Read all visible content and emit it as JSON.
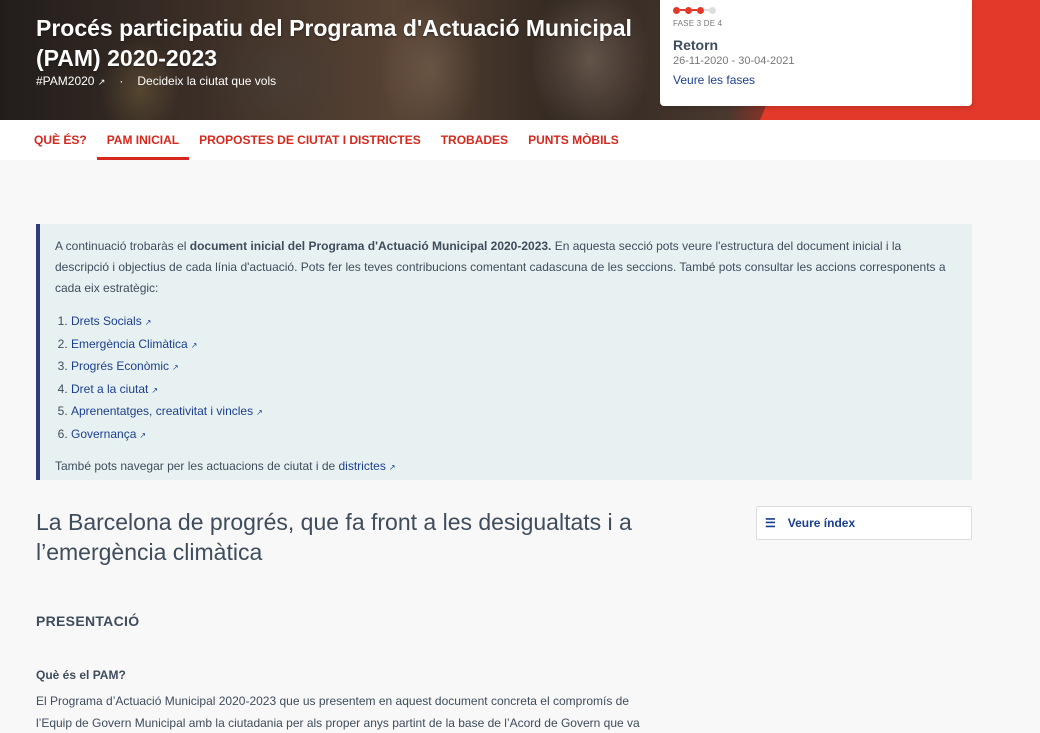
{
  "hero": {
    "title": "Procés participatiu del Programa d'Actuació Municipal (PAM) 2020-2023",
    "hashtag": "#PAM2020",
    "slogan": "Decideix la ciutat que vols"
  },
  "phase": {
    "step_label": "FASE 3 DE 4",
    "current": 3,
    "total": 4,
    "name": "Retorn",
    "dates": "26-11-2020 - 30-04-2021",
    "link": "Veure les fases"
  },
  "nav": {
    "items": [
      {
        "label": "QUÈ ÉS?"
      },
      {
        "label": "PAM INICIAL"
      },
      {
        "label": "PROPOSTES DE CIUTAT I DISTRICTES"
      },
      {
        "label": "TROBADES"
      },
      {
        "label": "PUNTS MÒBILS"
      }
    ],
    "active": "PAM INICIAL"
  },
  "callout": {
    "intro_pre": "A continuació trobaràs el ",
    "intro_bold": "document inicial del Programa d'Actuació Municipal 2020-2023.",
    "intro_post": " En aquesta secció pots veure l'estructura del document inicial i la descripció i objectius de cada línia d'actuació. Pots fer les teves contribucions comentant cadascuna de les seccions. També pots consultar les accions corresponents a cada eix estratègic:",
    "items": [
      {
        "label": "Drets Socials"
      },
      {
        "label": "Emergència Climàtica"
      },
      {
        "label": "Progrés Econòmic"
      },
      {
        "label": "Dret a la ciutat"
      },
      {
        "label": "Aprenentatges, creativitat i vincles"
      },
      {
        "label": "Governança"
      }
    ],
    "footer_pre": "També pots navegar per les actuacions de ciutat i de ",
    "footer_link": "districtes"
  },
  "main": {
    "title": "La Barcelona de progrés, que fa front a les desigualtats i a l’emergència climàtica",
    "index_button": "Veure índex",
    "section_heading": "PRESENTACIÓ",
    "subheading": "Què és el PAM?",
    "body": "El Programa d’Actuació Municipal 2020-2023 que us presentem en aquest document concreta el compromís de l’Equip de Govern Municipal amb la ciutadania per als proper anys partint de la base de l’Acord de Govern que va"
  },
  "colors": {
    "accent_red": "#e2392a",
    "link_blue": "#1a3f8f",
    "callout_bg": "#e8f1f2",
    "callout_border": "#2f3e76"
  },
  "icons": {
    "external_link": "external-link-icon",
    "list": "list-icon"
  }
}
